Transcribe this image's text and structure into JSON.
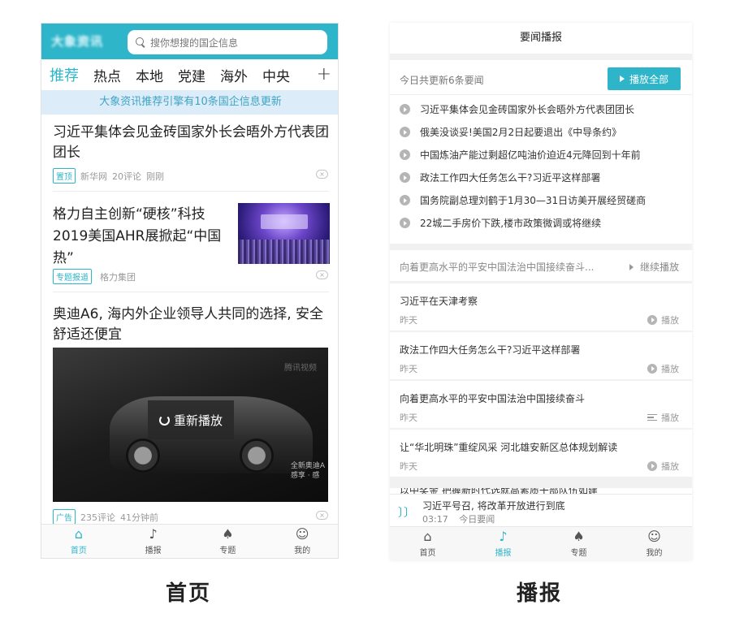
{
  "left": {
    "logo_text": "大象资讯",
    "search_placeholder": "搜你想搜的国企信息",
    "tabs": [
      "推荐",
      "热点",
      "本地",
      "党建",
      "海外",
      "中央"
    ],
    "tab_plus": "+",
    "banner": "大象资讯推荐引擎有10条国企信息更新",
    "news": [
      {
        "title": "习近平集体会见金砖国家外长会晤外方代表团团长",
        "tag": "置顶",
        "source": "新华网",
        "comments": "20评论",
        "time": "刚刚"
      },
      {
        "title": "格力自主创新“硬核”科技 2019美国AHR展掀起“中国热”",
        "tag": "专题报道",
        "source": "格力集团"
      },
      {
        "title": "奥迪A6, 海内外企业领导人共同的选择, 安全舒适还便宜",
        "tag": "广告",
        "comments": "235评论",
        "time": "41分钟前"
      }
    ],
    "video": {
      "replay_label": "重新播放",
      "watermark": "腾讯视频",
      "caption_line1": "全新奥迪A",
      "caption_line2": "感享 · 感"
    },
    "nav": [
      "首页",
      "播报",
      "专题",
      "我的"
    ]
  },
  "right": {
    "title": "要闻播报",
    "updated_text": "今日共更新6条要闻",
    "play_all": "播放全部",
    "headlines": [
      "习近平集体会见金砖国家外长会晤外方代表团团长",
      "俄美没谈妥!美国2月2日起要退出《中导条约》",
      "中国炼油产能过剩超亿吨油价迫近4元降回到十年前",
      "政法工作四大任务怎么干?习近平这样部署",
      "国务院副总理刘鹤于1月30—31日访美开展经贸磋商",
      "22城二手房价下跌,楼市政策微调或将继续"
    ],
    "continue_text": "向着更高水平的平安中国法治中国接续奋斗...",
    "continue_button": "继续播放",
    "items": [
      {
        "title": "习近平在天津考察",
        "date": "昨天",
        "action": "播放"
      },
      {
        "title": "政法工作四大任务怎么干?习近平这样部署",
        "date": "昨天",
        "action": "播放"
      },
      {
        "title": "向着更高水平的平安中国法治中国接续奋斗",
        "date": "昨天",
        "action": "播放"
      },
      {
        "title": "让“华北明珠”重绽风采  河北雄安新区总体规划解读",
        "date": "昨天",
        "action": "播放"
      }
    ],
    "cut_item": "以中奖金 把握新时代选就高素质干部队伍如建",
    "player": {
      "title": "习近平号召, 将改革开放进行到底",
      "time": "03:17",
      "label": "今日要闻"
    },
    "nav": [
      "首页",
      "播报",
      "专题",
      "我的"
    ]
  },
  "captions": {
    "left": "首页",
    "right": "播报"
  },
  "colors": {
    "accent": "#2fb5c9",
    "banner_bg": "#dcedf9"
  }
}
